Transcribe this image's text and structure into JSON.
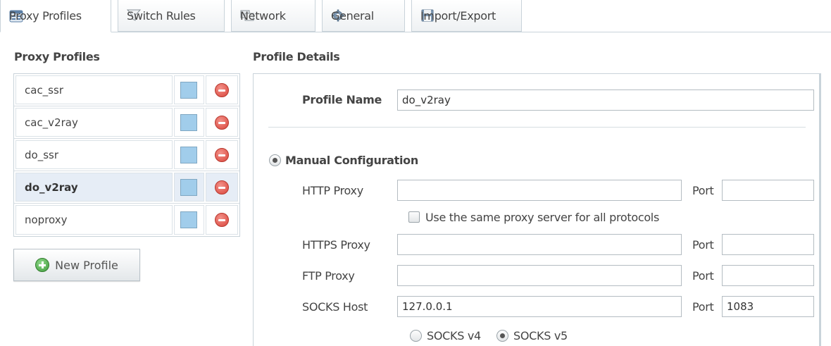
{
  "tabs": [
    {
      "label": "Proxy Profiles",
      "icon": "profiles-icon",
      "active": true
    },
    {
      "label": "Switch Rules",
      "icon": "filter-icon",
      "active": false
    },
    {
      "label": "Network",
      "icon": "network-icon",
      "active": false
    },
    {
      "label": "General",
      "icon": "gear-icon",
      "active": false
    },
    {
      "label": "Import/Export",
      "icon": "floppy-icon",
      "active": false
    }
  ],
  "left": {
    "title": "Proxy Profiles",
    "profiles": [
      {
        "name": "cac_ssr",
        "color": "#a1cdeb"
      },
      {
        "name": "cac_v2ray",
        "color": "#a1cdeb"
      },
      {
        "name": "do_ssr",
        "color": "#a1cdeb"
      },
      {
        "name": "do_v2ray",
        "color": "#a1cdeb",
        "selected": true
      },
      {
        "name": "noproxy",
        "color": "#a1cdeb"
      }
    ],
    "new_profile_label": "New Profile"
  },
  "details": {
    "title": "Profile Details",
    "profile_name_label": "Profile Name",
    "profile_name_value": "do_v2ray",
    "manual_config_label": "Manual Configuration",
    "http_label": "HTTP Proxy",
    "http_value": "",
    "http_port_label": "Port",
    "http_port_value": "",
    "same_proxy_label": "Use the same proxy server for all protocols",
    "https_label": "HTTPS Proxy",
    "https_value": "",
    "https_port_label": "Port",
    "https_port_value": "",
    "ftp_label": "FTP Proxy",
    "ftp_value": "",
    "ftp_port_label": "Port",
    "ftp_port_value": "",
    "socks_label": "SOCKS Host",
    "socks_value": "127.0.0.1",
    "socks_port_label": "Port",
    "socks_port_value": "1083",
    "socks_v4_label": "SOCKS v4",
    "socks_v5_label": "SOCKS v5",
    "socks_version_selected": "SOCKS v5"
  },
  "colors": {
    "accent_swatch": "#a1cdeb",
    "delete": "#d9443a",
    "add": "#3e9b3a",
    "selected_row": "#e6edf6"
  }
}
